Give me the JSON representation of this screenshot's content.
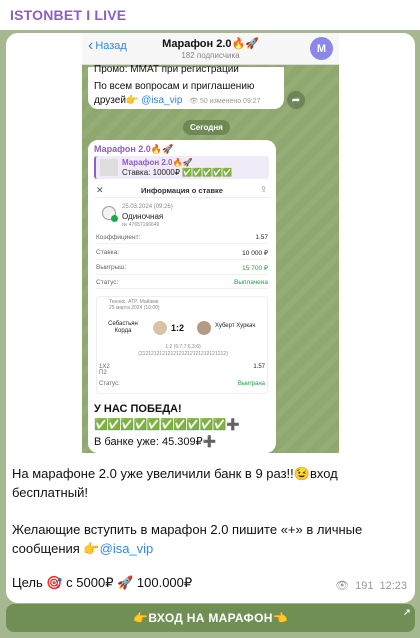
{
  "channel": {
    "title": "ISTONBET I LIVE"
  },
  "screenshot": {
    "back_label": "Назад",
    "chat_title": "Марафон 2.0🔥🚀",
    "subscribers": "182 подписчика",
    "avatar_letter": "M",
    "prev_message": {
      "line1": "Промо: MMAT при регистрации",
      "line2": "По всем вопросам и приглашению",
      "line3_prefix": "друзей👉",
      "link": "@isa_vip",
      "meta": "👁 50 изменено 09:27"
    },
    "date_pill": "Сегодня",
    "message": {
      "header": "Марафон 2.0🔥🚀",
      "quote_title": "Марафон 2.0🔥🚀",
      "quote_text": "Ставка: 10000₽ ✅✅✅✅✅",
      "bet_info": {
        "title": "Информация о ставке",
        "date": "25.03.2024 (09:26)",
        "type": "Одиночная",
        "number": "№ 47657166649",
        "rows": [
          {
            "k": "Коэффициент:",
            "v": "1.57"
          },
          {
            "k": "Ставка:",
            "v": "10 000 ₽"
          },
          {
            "k": "Выигрыш:",
            "v": "15 700 ₽"
          },
          {
            "k": "Статус:",
            "v": "Выплачена"
          }
        ],
        "match": {
          "league": "Теннис. ATP. Майами",
          "date": "25 марта 2024 (16:00)",
          "player1": "Себастьян Корда",
          "player2": "Хуберт Хуркач",
          "score": "1:2",
          "sets": "1:2 (6:7,7:6,3:6)",
          "points": "(2121212121212121212121212121212)",
          "bet_label": "1X2",
          "bet_value": "П2",
          "coef": "1.57",
          "status_label": "Статус:",
          "status": "Выиграна"
        }
      },
      "win_text": "У НАС ПОБЕДА!",
      "checks": "✅✅✅✅✅✅✅✅✅✅➕",
      "bank": "В банке уже: 45.309₽➕"
    }
  },
  "caption": {
    "p1": "На марафоне 2.0 уже увеличили банк в 9 раз!!😉вход бесплатный!",
    "p2_text": "Желающие вступить в марафон 2.0 пишите «+» в личные сообщения 👉",
    "p2_link": "@isa_vip",
    "p3": "Цель 🎯 с 5000₽ 🚀 100.000₽"
  },
  "stats": {
    "views": "191",
    "time": "12:23"
  },
  "cta": {
    "label": "👉ВХОД НА МАРАФОН👈",
    "arrow": "↗"
  }
}
